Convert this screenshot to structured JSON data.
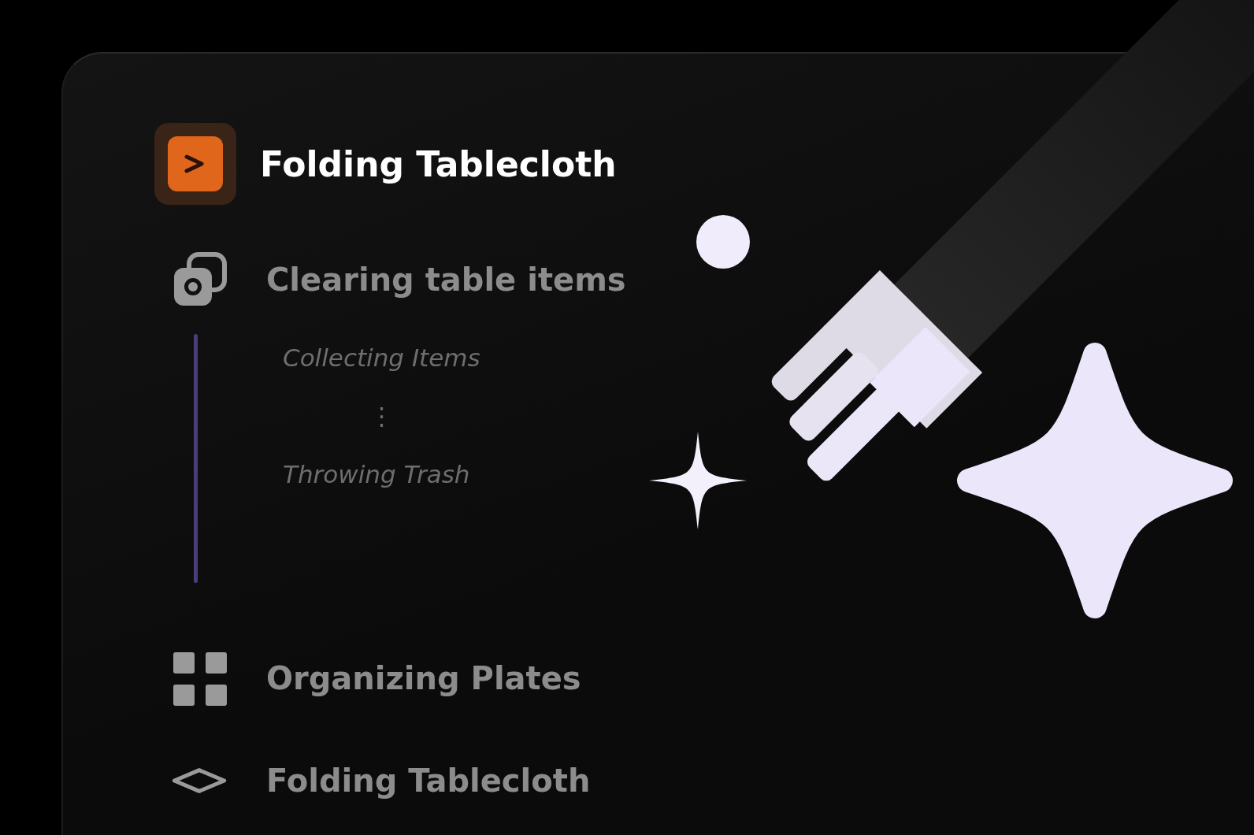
{
  "header": {
    "title": "Folding Tablecloth"
  },
  "items": [
    {
      "label": "Clearing table items",
      "children": [
        {
          "label": "Collecting Items"
        },
        {
          "label": "⋮"
        },
        {
          "label": "Throwing Trash"
        }
      ]
    },
    {
      "label": "Organizing Plates"
    },
    {
      "label": "Folding Tablecloth"
    }
  ]
}
